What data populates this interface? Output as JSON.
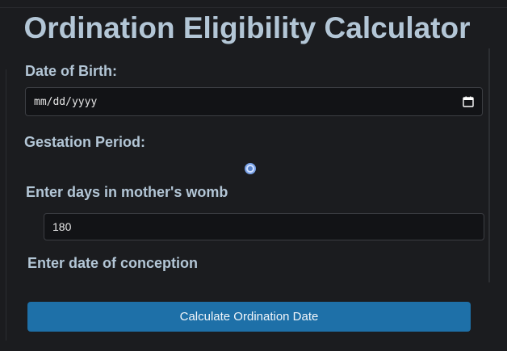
{
  "title": "Ordination Eligibility Calculator",
  "dob": {
    "label": "Date of Birth:",
    "placeholder": "mm/dd/yyyy",
    "icon": "calendar-icon"
  },
  "gestation": {
    "label": "Gestation Period:",
    "option_selected": true
  },
  "days": {
    "label": "Enter days in mother's womb",
    "value": "180"
  },
  "conception": {
    "label": "Enter date of conception"
  },
  "button": {
    "label": "Calculate Ordination Date",
    "color": "#1e70a8"
  },
  "colors": {
    "background": "#1b1c1f",
    "label": "#b3c6d6",
    "input_bg": "#121316"
  }
}
